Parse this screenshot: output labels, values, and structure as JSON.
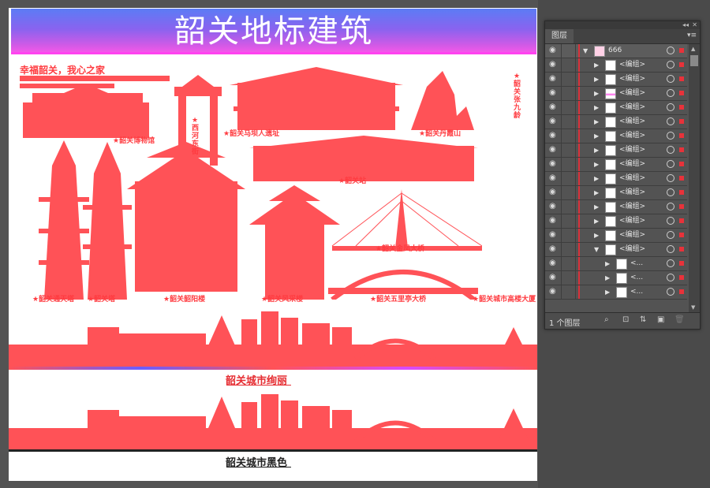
{
  "artboard": {
    "title": "韶关地标建筑",
    "slogan_line1": "幸福韶关，我心之家",
    "captions": {
      "colorful": "韶关城市绚丽",
      "black": "韶关城市黑色"
    },
    "labels": {
      "museum": "★韶关博物馆",
      "xihe_street": "★西河东街",
      "mabaren": "★韶关马坝人遗址",
      "danxia": "★韶关丹霞山",
      "zhang_jiuling": "★韶关张九龄",
      "station": "★韶关站",
      "golden_phoenix_bridge": "★韶关金凤大桥",
      "tongtian_tower": "★韶关通天塔",
      "fengcai_tower": "★韶关风采楼",
      "wuliting_bridge": "★韶关五里亭大桥",
      "tower2": "★韶关塔",
      "shaoyang_tower": "★韶关韶阳楼",
      "highrise": "★韶关城市高楼大厦"
    },
    "colors": {
      "silhouette": "#ff5257",
      "banner_top": "#5b7cf5",
      "banner_bottom": "#ff58ea"
    }
  },
  "layers_panel": {
    "tab": "图层",
    "layer_count": "1 个图层",
    "top_layer": {
      "name": "666"
    },
    "rows": [
      {
        "name": "<编组>",
        "thumb": "white"
      },
      {
        "name": "<编组>",
        "thumb": "white"
      },
      {
        "name": "<编组>",
        "thumb": "pink"
      },
      {
        "name": "<编组>",
        "thumb": "white"
      },
      {
        "name": "<编组>",
        "thumb": "white"
      },
      {
        "name": "<编组>",
        "thumb": "white"
      },
      {
        "name": "<编组>",
        "thumb": "white"
      },
      {
        "name": "<编组>",
        "thumb": "white"
      },
      {
        "name": "<编组>",
        "thumb": "white"
      },
      {
        "name": "<编组>",
        "thumb": "white"
      },
      {
        "name": "<编组>",
        "thumb": "white"
      },
      {
        "name": "<编组>",
        "thumb": "white"
      },
      {
        "name": "<编组>",
        "thumb": "white"
      },
      {
        "name": "<编组>",
        "thumb": "white",
        "expanded": true
      },
      {
        "name": "<...",
        "thumb": "white",
        "sub": true
      },
      {
        "name": "<...",
        "thumb": "white",
        "sub": true
      },
      {
        "name": "<...",
        "thumb": "white",
        "sub": true
      }
    ],
    "icons": [
      "search-icon",
      "new-sublayer-icon",
      "move-icon",
      "new-layer-icon",
      "trash-icon"
    ]
  }
}
